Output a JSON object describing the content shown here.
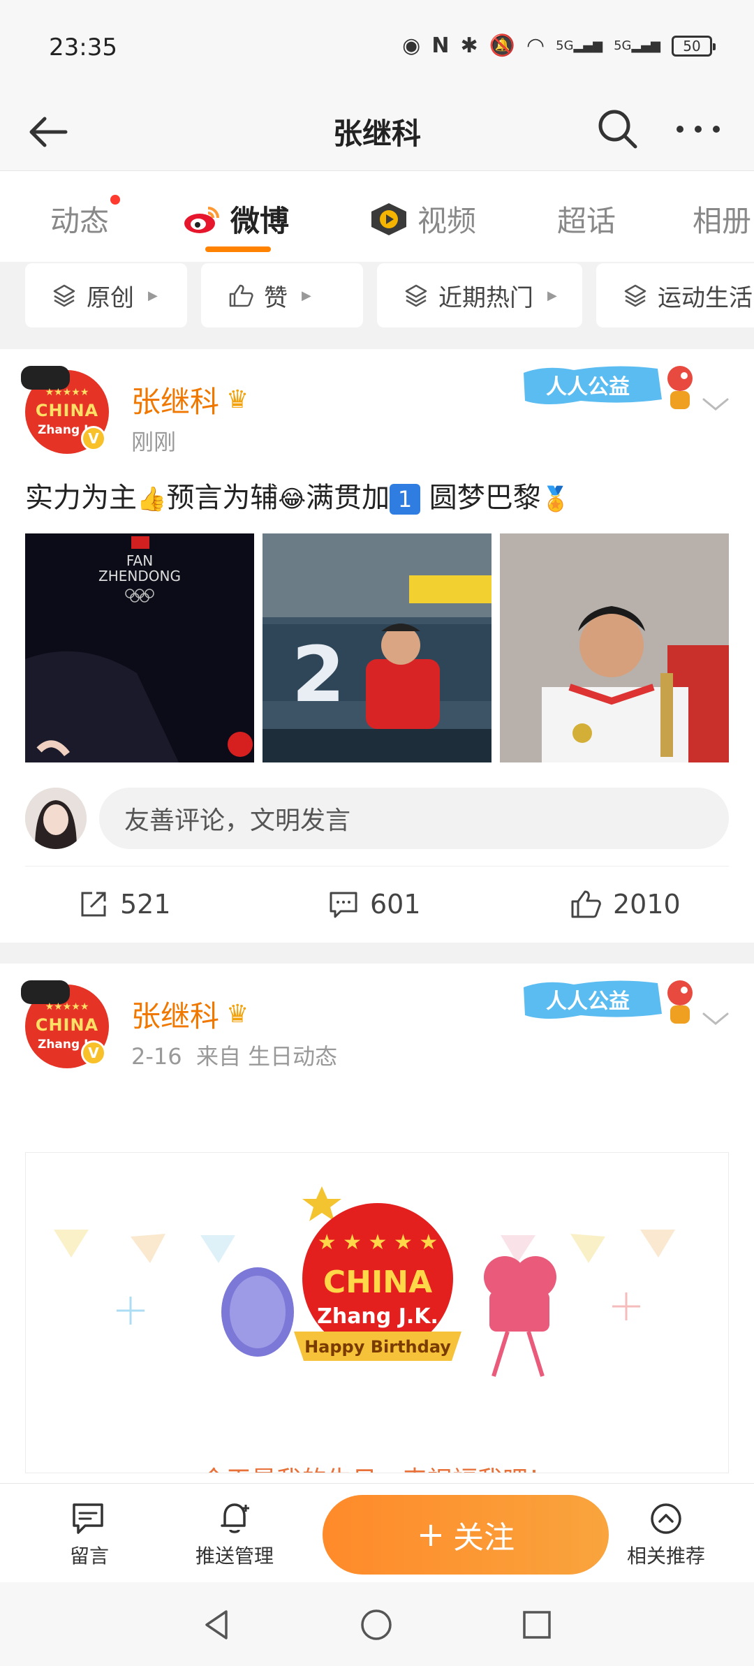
{
  "status_bar": {
    "time": "23:35",
    "network": "5G",
    "battery": "50"
  },
  "header": {
    "title": "张继科"
  },
  "tabs": [
    {
      "label": "动态",
      "has_dot": true
    },
    {
      "label": "微博",
      "active": true
    },
    {
      "label": "视频"
    },
    {
      "label": "超话"
    },
    {
      "label": "相册"
    }
  ],
  "filters": [
    {
      "label": "原创"
    },
    {
      "label": "赞"
    },
    {
      "label": "近期热门"
    },
    {
      "label": "运动生活"
    }
  ],
  "posts": [
    {
      "author": "张继科",
      "avatar_text": "CHINA",
      "avatar_sub": "Zhang J",
      "time": "刚刚",
      "badge": "人人公益",
      "text_parts": [
        "实力为主",
        "预言为辅",
        "满贯加",
        "1",
        " 圆梦巴黎"
      ],
      "images": [
        {
          "caption_line1": "FAN",
          "caption_line2": "ZHENDONG"
        },
        {
          "jersey_number": "2"
        },
        {}
      ],
      "comment_placeholder": "友善评论，文明发言",
      "reposts": "521",
      "comments": "601",
      "likes": "2010"
    },
    {
      "author": "张继科",
      "time": "2-16",
      "source": "来自 生日动态",
      "badge": "人人公益",
      "card_title": "CHINA",
      "card_name": "Zhang J.K.",
      "card_ribbon": "Happy Birthday",
      "card_caption": "今天是我的生日，来祝福我吧！"
    }
  ],
  "bottom_bar": {
    "message": "留言",
    "push": "推送管理",
    "follow": "关注",
    "related": "相关推荐"
  },
  "colors": {
    "accent": "#ff8200",
    "name": "#f07800",
    "follow_gradient_start": "#ff8a2a",
    "follow_gradient_end": "#f9a43d"
  }
}
